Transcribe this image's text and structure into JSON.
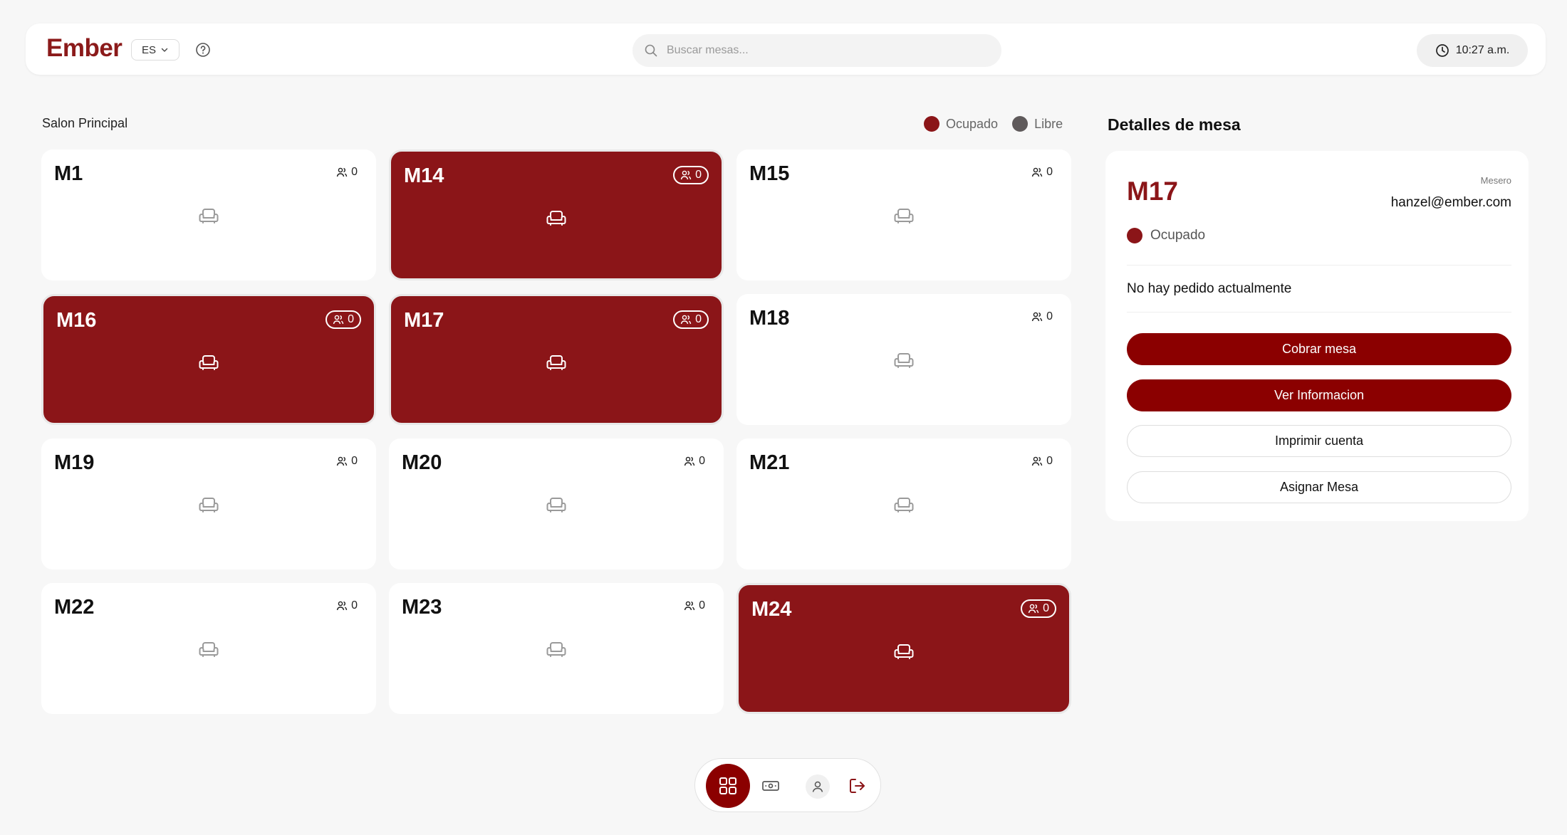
{
  "header": {
    "logo": "Ember",
    "language": "ES",
    "search_placeholder": "Buscar mesas...",
    "time": "10:27 a.m."
  },
  "room": {
    "title": "Salon Principal",
    "legend": {
      "occupied": "Ocupado",
      "free": "Libre"
    }
  },
  "colors": {
    "brand": "#8b1518",
    "occupied": "#8b1518",
    "free": "#5f5a5b",
    "button_primary": "#8b0000"
  },
  "tables": [
    {
      "name": "M1",
      "guests": "0",
      "occupied": false
    },
    {
      "name": "M14",
      "guests": "0",
      "occupied": true
    },
    {
      "name": "M15",
      "guests": "0",
      "occupied": false
    },
    {
      "name": "M16",
      "guests": "0",
      "occupied": true
    },
    {
      "name": "M17",
      "guests": "0",
      "occupied": true
    },
    {
      "name": "M18",
      "guests": "0",
      "occupied": false
    },
    {
      "name": "M19",
      "guests": "0",
      "occupied": false
    },
    {
      "name": "M20",
      "guests": "0",
      "occupied": false
    },
    {
      "name": "M21",
      "guests": "0",
      "occupied": false
    },
    {
      "name": "M22",
      "guests": "0",
      "occupied": false
    },
    {
      "name": "M23",
      "guests": "0",
      "occupied": false
    },
    {
      "name": "M24",
      "guests": "0",
      "occupied": true
    }
  ],
  "details": {
    "title": "Detalles de mesa",
    "table": "M17",
    "waiter_label": "Mesero",
    "waiter": "hanzel@ember.com",
    "status": "Ocupado",
    "order_message": "No hay pedido actualmente",
    "buttons": {
      "charge": "Cobrar mesa",
      "info": "Ver Informacion",
      "print": "Imprimir cuenta",
      "assign": "Asignar Mesa"
    }
  },
  "icons": {
    "help": "help-circle-icon",
    "search": "search-icon",
    "clock": "clock-icon",
    "guests": "users-icon",
    "seat": "armchair-icon",
    "nav": [
      "dashboard-grid-icon",
      "cash-icon",
      "user-icon",
      "logout-icon"
    ]
  }
}
